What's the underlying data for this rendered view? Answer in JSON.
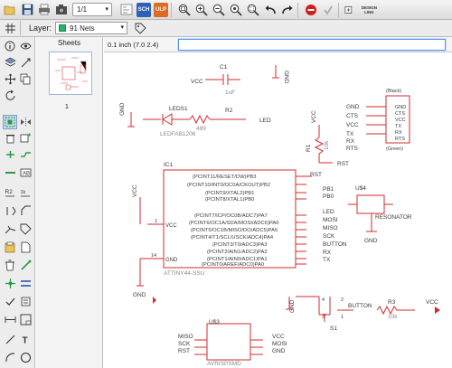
{
  "toolbar": {
    "page_value": "1/1",
    "icons": [
      "open-icon",
      "save-icon",
      "print-icon",
      "cam-icon",
      "board-icon",
      "sch-badge",
      "ulp-badge",
      "zoom-fit-icon",
      "zoom-in-icon",
      "zoom-out-icon",
      "zoom-select-icon",
      "zoom-area-icon",
      "undo-icon",
      "redo-icon",
      "stop-icon",
      "go-icon",
      "design-link-icon"
    ],
    "sch_label": "SCH",
    "ulp_label": "ULP",
    "design_link_label": "DESIGN LINK"
  },
  "toolbar2": {
    "layer_label": "Layer:",
    "layer_value": "91 Nets"
  },
  "sheets": {
    "header": "Sheets",
    "items": [
      {
        "number": "1"
      }
    ]
  },
  "command": {
    "coordinate": "0.1 inch (7.0 2.4)",
    "value": ""
  },
  "schematic": {
    "labels": {
      "vcc_top": "VCC",
      "c1_name": "C1",
      "c1_value": "1uF",
      "gnd_top": "GND",
      "d1_name": "LEDS1",
      "d1_value": "LEDFAB1206",
      "r2_name": "R2",
      "r2_value": "499",
      "led_net": "LED",
      "gnd_left": "GND",
      "vcc_r1": "VCC",
      "r1_name": "R1",
      "r1_value": "10k",
      "rst_net": "RST",
      "j1_pins": [
        "GND",
        "CTS",
        "VCC",
        "TX",
        "RX",
        "RTS"
      ],
      "j1_black": "(Black)",
      "j1_green": "(Green)",
      "ic1_name": "IC1",
      "ic1_value": "ATTINY44-SSU",
      "ic1_pins_top": [
        "(PCINT11/RESET/DW)PB3",
        "(PCINT10/INT0/OC0A/CKOUT)PB2",
        "(PCINT9/XTAL2)PB1",
        "(PCINT8/XTAL1)PB0"
      ],
      "ic1_pins_bottom": [
        "(PCINT7/ICP/OC0B/ADC7)PA7",
        "(PCINT6/OC1A/SDA/MOSI/ADC6)PA6",
        "(PCINT5/OC1B/MISO/DO/ADC5)PA5",
        "(PCINT4/T1/SCL/USCK/ADC4)PA4",
        "(PCINT3/T0/ADC3)PA3",
        "(PCINT2/AIN1/ADC2)PA2",
        "(PCINT1/AIN0/ADC1)PA1",
        "(PCINT0/AREF/ADC0)PA0"
      ],
      "ic1_vcc": "VCC",
      "ic1_gnd": "GND",
      "ic1_pin1": "1",
      "ic1_pin14": "14",
      "vcc_ic": "VCC",
      "gnd_ic": "GND",
      "right_nets_top": [
        "RST",
        "PB1",
        "PB0"
      ],
      "right_nets_bottom": [
        "LED",
        "MOSI",
        "MISO",
        "SCK",
        "BUTTON",
        "RX",
        "TX"
      ],
      "u4_name": "U$4",
      "resonator": "RESONATOR",
      "gnd_res": "GND",
      "gnd_btn": "GND",
      "s1_name": "S1",
      "s1_pin4": "4",
      "s1_pin2": "2",
      "s1_pin3": "3",
      "s1_pin1": "1",
      "button_net": "BUTTON",
      "r3_name": "R3",
      "r3_value": "10k",
      "vcc_r3": "VCC",
      "u3_name": "U$3",
      "u3_value": "AVRISPSMD",
      "isp_left": [
        "MISO",
        "SCK",
        "RST"
      ],
      "isp_right": [
        "VCC",
        "MOSI",
        "GND"
      ]
    }
  },
  "colors": {
    "wire": "#d62b2b",
    "net_text": "#3b3b3b",
    "label_text": "#8a8a8a",
    "component": "#c81f1f",
    "accent": "#4d90fe",
    "layer_swatch": "#25b46b"
  }
}
